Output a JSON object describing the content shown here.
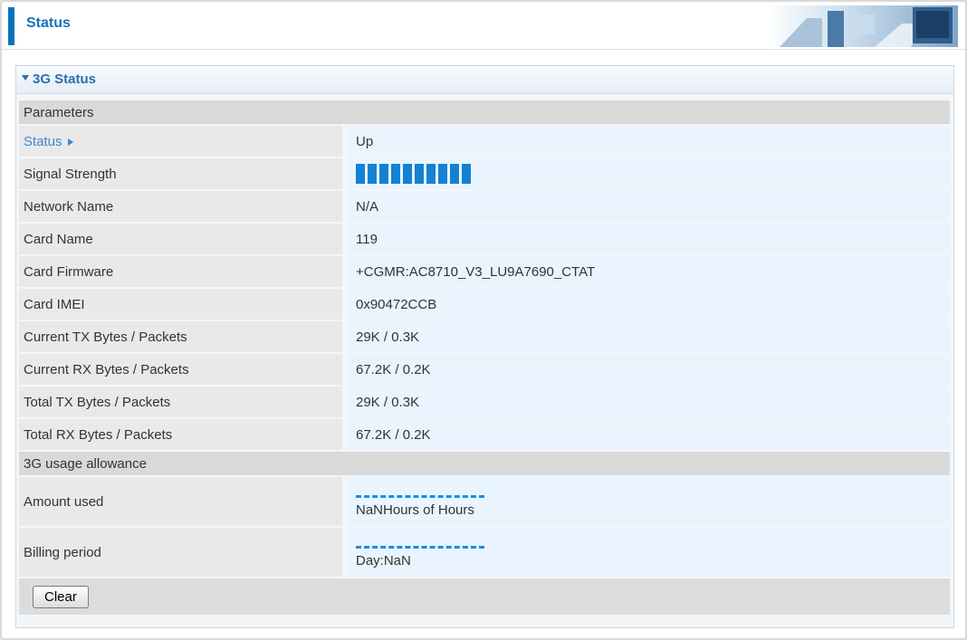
{
  "header": {
    "title": "Status"
  },
  "panel": {
    "title": "3G Status"
  },
  "sections": {
    "parameters": "Parameters",
    "usage": "3G usage allowance"
  },
  "rows": [
    {
      "key": "Status",
      "value": "Up"
    },
    {
      "key": "Signal Strength",
      "value": ""
    },
    {
      "key": "Network Name",
      "value": "N/A"
    },
    {
      "key": "Card Name",
      "value": "119"
    },
    {
      "key": "Card Firmware",
      "value": "+CGMR:AC8710_V3_LU9A7690_CTAT"
    },
    {
      "key": "Card IMEI",
      "value": "0x90472CCB"
    },
    {
      "key": "Current TX Bytes / Packets",
      "value": "29K / 0.3K"
    },
    {
      "key": "Current RX Bytes / Packets",
      "value": "67.2K / 0.2K"
    },
    {
      "key": "Total TX Bytes / Packets",
      "value": "29K / 0.3K"
    },
    {
      "key": "Total RX Bytes / Packets",
      "value": "67.2K / 0.2K"
    }
  ],
  "signal_strength_bars": 10,
  "usage": {
    "amount_label": "Amount used",
    "amount_value": "NaNHours of Hours",
    "billing_label": "Billing period",
    "billing_value": "Day:NaN"
  },
  "buttons": {
    "clear": "Clear"
  },
  "colors": {
    "accent": "#1672b6",
    "signal": "#1481d4",
    "value_bg": "#e9f4ff"
  }
}
